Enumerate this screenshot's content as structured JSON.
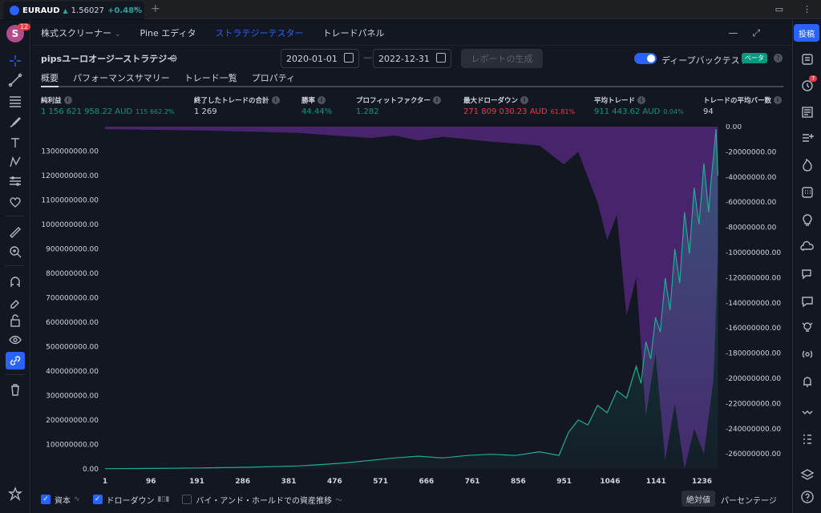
{
  "window": {
    "tab": {
      "symbol": "EURAUD",
      "arrow": "▲",
      "price": "1.56027",
      "change": "+0.48%",
      "close": "×"
    },
    "new_tab": "+"
  },
  "user": {
    "avatar_letter": "S",
    "notifications": "12"
  },
  "topnav": {
    "items": [
      {
        "label": "株式スクリーナー",
        "active": false,
        "has_dropdown": true
      },
      {
        "label": "Pine エディタ",
        "active": false
      },
      {
        "label": "ストラテジーテスター",
        "active": true
      },
      {
        "label": "トレードパネル",
        "active": false
      }
    ],
    "publish": "投稿"
  },
  "strategy": {
    "name": "pipsユーロオージーストラテジー",
    "date_from": "2020-01-01",
    "date_sep": "—",
    "date_to": "2022-12-31",
    "generate_button": "レポートの生成",
    "deep_backtest_label": "ディープバックテスト",
    "deep_backtest_enabled": true,
    "beta": "ベータ",
    "help": "?"
  },
  "subtabs": [
    "概要",
    "パフォーマンスサマリー",
    "トレード一覧",
    "プロパティ"
  ],
  "metrics": [
    {
      "title": "純利益",
      "value": "1 156 621 958.22 AUD",
      "sub": "115 662.2%",
      "tone": "pos"
    },
    {
      "title": "終了したトレードの合計",
      "value": "1 269",
      "sub": "",
      "tone": "neu"
    },
    {
      "title": "勝率",
      "value": "44.44%",
      "sub": "",
      "tone": "pos"
    },
    {
      "title": "プロフィットファクター",
      "value": "1.282",
      "sub": "",
      "tone": "pos"
    },
    {
      "title": "最大ドローダウン",
      "value": "271 809 030.23 AUD",
      "sub": "61.81%",
      "tone": "neg"
    },
    {
      "title": "平均トレード",
      "value": "911 443.62 AUD",
      "sub": "0.04%",
      "tone": "pos"
    },
    {
      "title": "トレードの平均バー数",
      "value": "94",
      "sub": "",
      "tone": "neu"
    }
  ],
  "chart_data": {
    "type": "area",
    "title": "",
    "x_ticks": [
      "1",
      "96",
      "191",
      "286",
      "381",
      "476",
      "571",
      "666",
      "761",
      "856",
      "951",
      "1046",
      "1141",
      "1236"
    ],
    "xlim": [
      1,
      1275
    ],
    "left_axis": {
      "ticks": [
        "0.00",
        "100000000.00",
        "200000000.00",
        "300000000.00",
        "400000000.00",
        "500000000.00",
        "600000000.00",
        "700000000.00",
        "800000000.00",
        "900000000.00",
        "1000000000.00",
        "1100000000.00",
        "1200000000.00",
        "1300000000.00"
      ],
      "ylim": [
        0,
        1400000000
      ]
    },
    "right_axis": {
      "ticks": [
        "0.00",
        "-20000000.00",
        "-40000000.00",
        "-60000000.00",
        "-80000000.00",
        "-100000000.00",
        "-120000000.00",
        "-140000000.00",
        "-160000000.00",
        "-180000000.00",
        "-200000000.00",
        "-220000000.00",
        "-240000000.00",
        "-260000000.00"
      ],
      "ylim": [
        -272000000,
        0
      ]
    },
    "series": [
      {
        "name": "資本",
        "color": "#22ab94",
        "x": [
          1,
          100,
          200,
          300,
          400,
          450,
          500,
          550,
          600,
          650,
          700,
          750,
          800,
          850,
          900,
          940,
          960,
          980,
          1000,
          1020,
          1040,
          1060,
          1080,
          1100,
          1110,
          1120,
          1130,
          1140,
          1150,
          1160,
          1170,
          1180,
          1190,
          1200,
          1210,
          1220,
          1230,
          1240,
          1250,
          1255,
          1260,
          1265,
          1269
        ],
        "values": [
          1000000,
          2000000,
          4000000,
          7000000,
          12000000,
          18000000,
          25000000,
          35000000,
          45000000,
          52000000,
          45000000,
          55000000,
          60000000,
          55000000,
          70000000,
          55000000,
          150000000,
          200000000,
          180000000,
          260000000,
          230000000,
          320000000,
          290000000,
          420000000,
          350000000,
          520000000,
          450000000,
          620000000,
          560000000,
          780000000,
          650000000,
          900000000,
          760000000,
          1050000000,
          880000000,
          1150000000,
          1000000000,
          1250000000,
          1050000000,
          1180000000,
          1280000000,
          1390000000,
          1200000000
        ]
      },
      {
        "name": "ドローダウン",
        "color": "#5b2a86",
        "x": [
          1,
          200,
          400,
          550,
          600,
          650,
          700,
          800,
          900,
          950,
          980,
          1000,
          1020,
          1040,
          1060,
          1080,
          1100,
          1120,
          1140,
          1160,
          1180,
          1200,
          1220,
          1240,
          1260,
          1269
        ],
        "values": [
          -2000000,
          -3000000,
          -5000000,
          -9000000,
          -7000000,
          -11000000,
          -8000000,
          -12000000,
          -15000000,
          -30000000,
          -20000000,
          -40000000,
          -60000000,
          -90000000,
          -70000000,
          -150000000,
          -120000000,
          -230000000,
          -180000000,
          -265000000,
          -220000000,
          -272000000,
          -240000000,
          -260000000,
          -200000000,
          -100000000
        ]
      }
    ],
    "legend": [
      {
        "label": "資本",
        "checked": true
      },
      {
        "label": "ドローダウン",
        "checked": true
      },
      {
        "label": "バイ・アンド・ホールドでの資産推移",
        "checked": false
      }
    ],
    "scale_buttons": [
      "絶対値",
      "パーセンテージ"
    ],
    "active_scale": "絶対値",
    "grid": false
  }
}
